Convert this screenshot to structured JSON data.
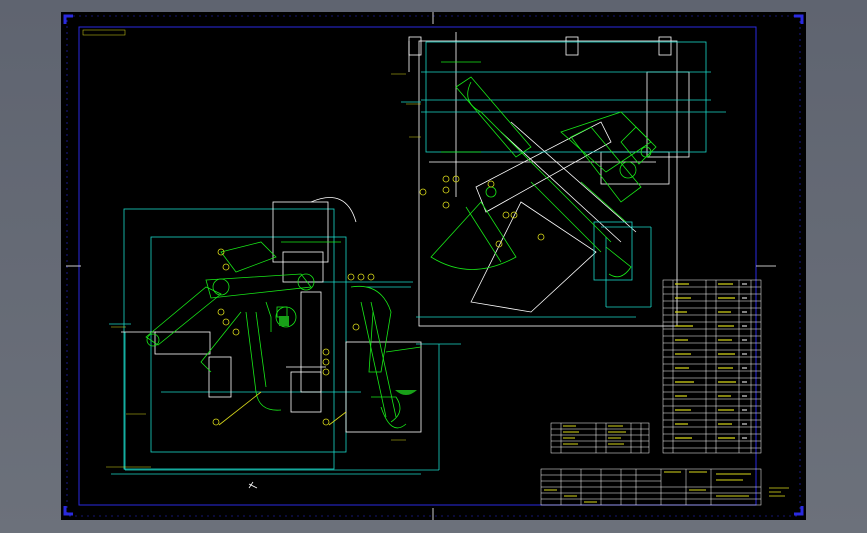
{
  "drawing": {
    "corner_label": "",
    "background": "#000000",
    "colors": {
      "frame": "#1f1fd9",
      "green": "#18e818",
      "cyan": "#1ad9c9",
      "white": "#ffffff",
      "yellow": "#d8d81a"
    },
    "title_block_text": [
      "",
      "",
      ""
    ]
  }
}
